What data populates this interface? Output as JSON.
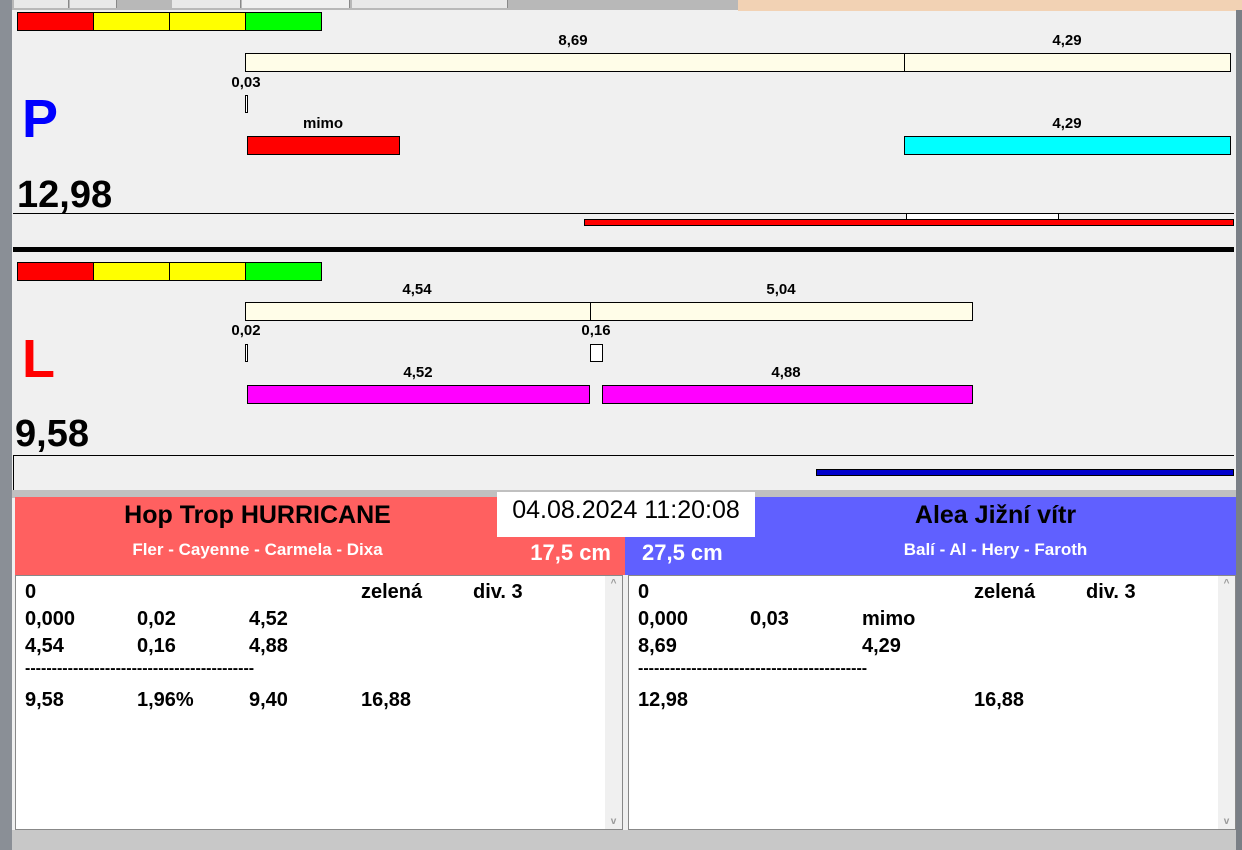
{
  "colors": {
    "red": "#ff0000",
    "yellow": "#ffff00",
    "green": "#00ff00",
    "cream": "#fffde8",
    "cyan": "#00ffff",
    "magenta": "#ff00ff",
    "header_left": "#ff6060",
    "header_right": "#6060ff"
  },
  "panel_p": {
    "letter": "P",
    "total": "12,98",
    "row1": [
      "8,69",
      "4,29"
    ],
    "gap": "0,03",
    "row2": [
      "mimo",
      "4,29"
    ]
  },
  "panel_l": {
    "letter": "L",
    "total": "9,58",
    "row1": [
      "4,54",
      "5,04"
    ],
    "gaps": [
      "0,02",
      "0,16"
    ],
    "row2": [
      "4,52",
      "4,88"
    ]
  },
  "header": {
    "datetime": "04.08.2024 11:20:08",
    "left": {
      "name": "Hop Trop HURRICANE",
      "pedigree": "Fler - Cayenne - Carmela - Dixa",
      "size": "17,5 cm"
    },
    "right": {
      "name": "Alea Jižní vítr",
      "pedigree": "Balí - Al - Hery - Faroth",
      "size": "27,5 cm"
    }
  },
  "left_text": {
    "r0": [
      "0",
      "zelená",
      "div. 3"
    ],
    "r1": [
      "0,000",
      "0,02",
      "4,52"
    ],
    "r2": [
      "4,54",
      "0,16",
      "4,88"
    ],
    "sep": "-------------------------------------------",
    "r3": [
      "9,58",
      "1,96%",
      "9,40",
      "16,88"
    ]
  },
  "right_text": {
    "r0": [
      "0",
      "zelená",
      "div. 3"
    ],
    "r1": [
      "0,000",
      "0,03",
      "mimo"
    ],
    "r2": [
      "8,69",
      "4,29"
    ],
    "sep": "-------------------------------------------",
    "r3": [
      "12,98",
      "16,88"
    ]
  },
  "scroll": {
    "up": "^",
    "down": "v"
  }
}
